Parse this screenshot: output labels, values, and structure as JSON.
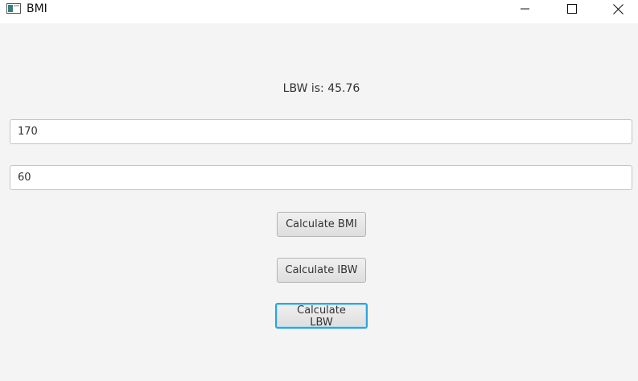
{
  "window": {
    "title": "BMI",
    "icon": "app-window-icon",
    "controls": {
      "minimize_icon": "minimize-icon",
      "maximize_icon": "maximize-icon",
      "close_icon": "close-icon"
    }
  },
  "result": {
    "text": "LBW is: 45.76"
  },
  "inputs": {
    "height_value": "170",
    "weight_value": "60"
  },
  "buttons": {
    "bmi_label": "Calculate BMI",
    "ibw_label": "Calculate IBW",
    "lbw_label": "Calculate LBW"
  },
  "colors": {
    "background": "#f4f4f4",
    "focus_accent": "#2aa6df"
  }
}
